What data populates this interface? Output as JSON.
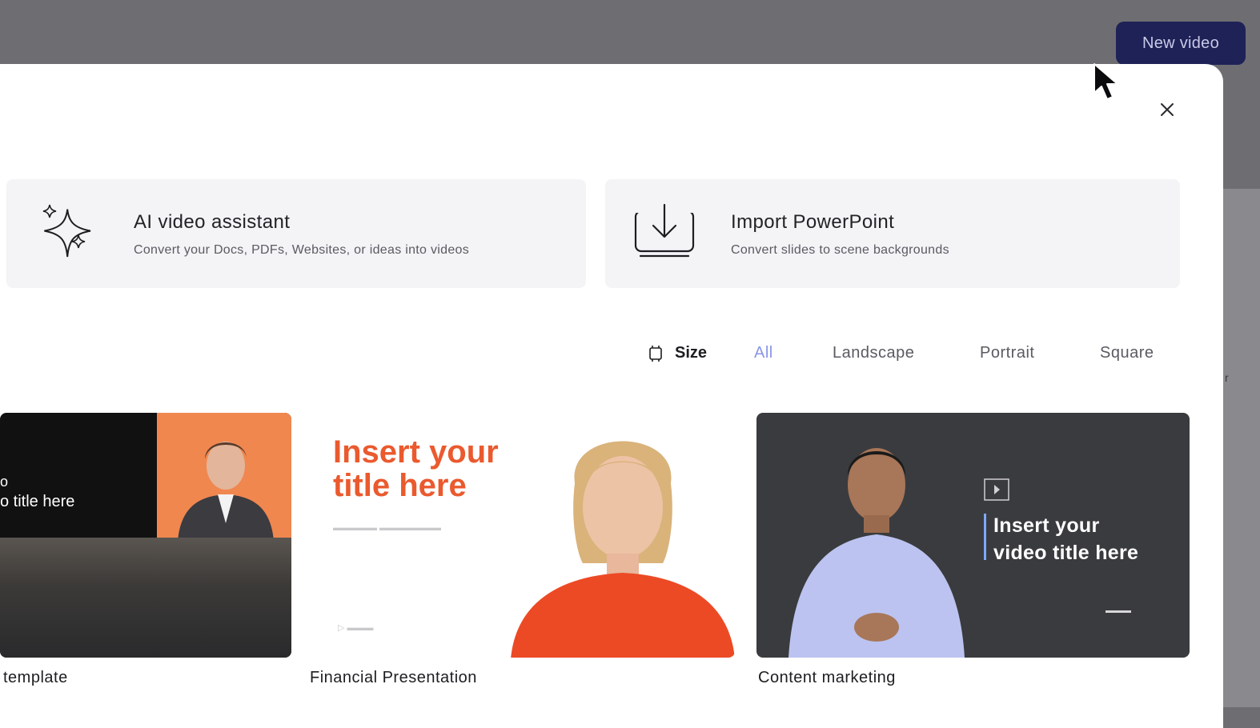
{
  "header": {
    "new_video_label": "New video"
  },
  "backdrop_fragments": [
    "r"
  ],
  "cards": [
    {
      "title": "AI video assistant",
      "subtitle": "Convert your Docs, PDFs, Websites, or ideas into videos",
      "icon": "sparkles-icon"
    },
    {
      "title": "Import PowerPoint",
      "subtitle": "Convert slides to scene backgrounds",
      "icon": "import-icon"
    }
  ],
  "filter": {
    "label": "Size",
    "options": [
      "All",
      "Landscape",
      "Portrait",
      "Square"
    ],
    "selected": "All"
  },
  "templates": [
    {
      "caption": "template",
      "thumb_line1": "o",
      "thumb_line2": "o title here"
    },
    {
      "caption": "Financial Presentation",
      "thumb_headline": "Insert your\ntitle here"
    },
    {
      "caption": "Content marketing",
      "thumb_headline": "Insert your\nvideo title here"
    }
  ],
  "colors": {
    "accent": "#8a96e6",
    "button_bg": "#1e2257",
    "financial_orange": "#ea5a2e",
    "template_orange": "#f0874f"
  }
}
